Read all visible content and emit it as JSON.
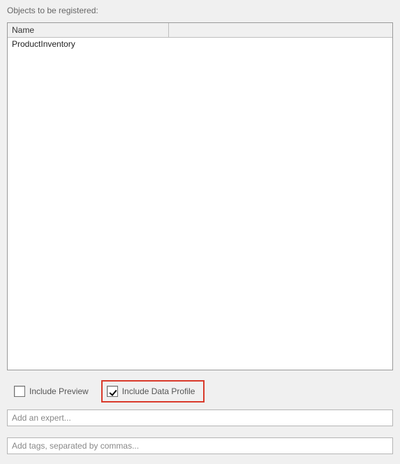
{
  "section_label": "Objects to be registered:",
  "table": {
    "headers": {
      "name": "Name",
      "blank": ""
    },
    "rows": [
      {
        "name": "ProductInventory"
      }
    ]
  },
  "checkboxes": {
    "include_preview": {
      "label": "Include Preview",
      "checked": false
    },
    "include_data_profile": {
      "label": "Include Data Profile",
      "checked": true
    }
  },
  "inputs": {
    "expert": {
      "placeholder": "Add an expert..."
    },
    "tags": {
      "placeholder": "Add tags, separated by commas..."
    }
  }
}
